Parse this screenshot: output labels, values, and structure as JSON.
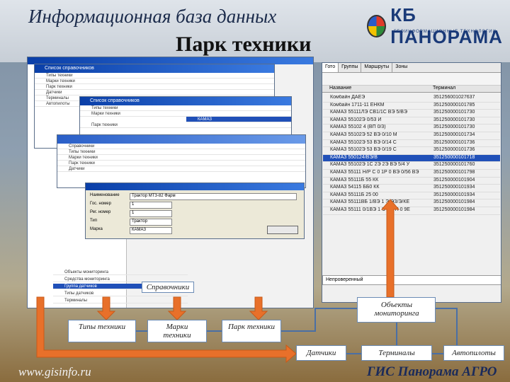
{
  "header": {
    "subtitle": "Информационная база данных",
    "title": "Парк техники",
    "logo_text": "КБ ПАНОРАМА",
    "logo_tagline": "ГЕОИНФОРМАЦИОННЫЕ ТЕХНОЛОГИИ"
  },
  "screens": {
    "main_window_caption": "Список справочников",
    "child_window_caption": "Список справочников",
    "right_tabs": [
      "Гото",
      "Группы",
      "Маршруты",
      "Зоны"
    ],
    "right_table": {
      "headers": [
        "Название",
        "Терминал"
      ],
      "rows": [
        [
          "Комбайн ДАЕЭ",
          "351256001027637"
        ],
        [
          "Комбайн 1711-11 ЕНКМ",
          "351250000101785"
        ],
        [
          "КАМАЗ 55111ЛЭ СВ1/1С ВЭ 5/ВЭ",
          "351250000101730"
        ],
        [
          "КАМАЗ 55102Э 0/53 И",
          "351250000101730"
        ],
        [
          "КАМАЗ 55102 4 (ВП 0/3)",
          "351250000101730"
        ],
        [
          "КАМАЗ 55102Э 52 ВЭ 0/10 М",
          "351250000101734"
        ],
        [
          "КАМАЗ 55102Э 53 ВЭ 0/14 С",
          "351250000101736"
        ],
        [
          "КАМАЗ 55102Э 53 ВЭ 0/19 С",
          "351250000101736"
        ],
        [
          "КАМАЗ 550124/ВЭ/В",
          "351250000101718"
        ],
        [
          "КАМАЗ 55102Э 1С 2Э 2Э ВЭ 5/4 У",
          "351250000101760"
        ],
        [
          "КАМАЗ 55111 Н/Р С 0 1Р 0 ВЭ 0/56 ВЭ",
          "351250000101798"
        ],
        [
          "КАМАЗ 55111Б 55 КК",
          "351250000101904"
        ],
        [
          "КАМАЗ 54115 ББ0 КК",
          "351250000101934"
        ],
        [
          "КАМАЗ 55111Б 25 00",
          "351250000101934"
        ],
        [
          "КАМАЗ 55111ВБ 1/ВЭ 1 Э/ЭЗ/Э/КЕ",
          "351250000101984"
        ],
        [
          "КАМАЗ 55111 0/1ВЭ 1 Э 2 1 Н 0 9Е",
          "351250000101984"
        ]
      ],
      "lower_field": "Непроверенный"
    },
    "form": {
      "fields": [
        {
          "label": "Наименование",
          "value": "Трактор МТЗ-82 Фарм"
        },
        {
          "label": "Гос. номер",
          "value": "1"
        },
        {
          "label": "Рег. номер",
          "value": "1"
        },
        {
          "label": "Тип",
          "value": "Трактор"
        },
        {
          "label": "Марка",
          "value": "КАМАЗ"
        }
      ]
    }
  },
  "diagram": {
    "label_reference": "Справочники",
    "label_monitoring": "Объекты мониторинга",
    "label_types": "Типы техники",
    "label_brands": "Марки техники",
    "label_fleet": "Парк техники",
    "label_sensors": "Датчики",
    "label_terminals": "Терминалы",
    "label_autopilots": "Автопилоты",
    "arrow_color": "#e8702a",
    "line_color": "#4a6fa5"
  },
  "footer": {
    "url": "www.gisinfo.ru",
    "brand": "ГИС Панорама АГРО"
  }
}
